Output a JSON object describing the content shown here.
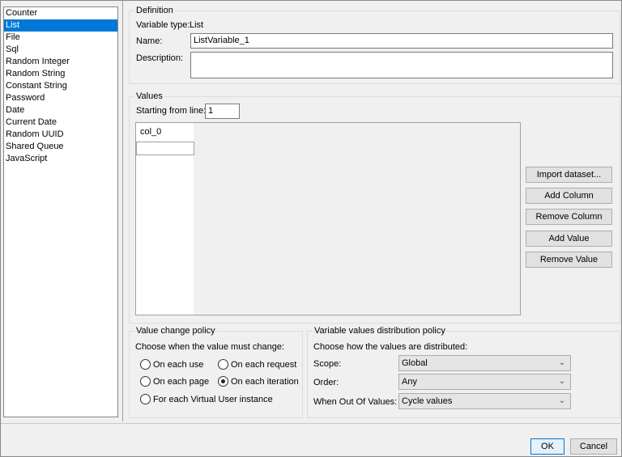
{
  "sidebar": {
    "items": [
      "Counter",
      "List",
      "File",
      "Sql",
      "Random Integer",
      "Random String",
      "Constant String",
      "Password",
      "Date",
      "Current Date",
      "Random UUID",
      "Shared Queue",
      "JavaScript"
    ],
    "selected": "List"
  },
  "definition": {
    "title": "Definition",
    "type_label": "Variable type:",
    "type_value": "List",
    "name_label": "Name:",
    "name_value": "ListVariable_1",
    "description_label": "Description:",
    "description_value": ""
  },
  "values": {
    "title": "Values",
    "start_label": "Starting from line:",
    "start_value": "1",
    "column_header": "col_0",
    "buttons": [
      "Import dataset...",
      "Add Column",
      "Remove Column",
      "Add Value",
      "Remove Value"
    ]
  },
  "change_policy": {
    "title": "Value change policy",
    "prompt": "Choose when the value must change:",
    "options": [
      "On each use",
      "On each request",
      "On each page",
      "On each iteration",
      "For each Virtual User instance"
    ],
    "selected": "On each iteration"
  },
  "distribution": {
    "title": "Variable values distribution policy",
    "prompt": "Choose how the values are distributed:",
    "scope_label": "Scope:",
    "scope_value": "Global",
    "order_label": "Order:",
    "order_value": "Any",
    "out_label": "When Out Of Values:",
    "out_value": "Cycle values"
  },
  "footer": {
    "ok": "OK",
    "cancel": "Cancel"
  }
}
